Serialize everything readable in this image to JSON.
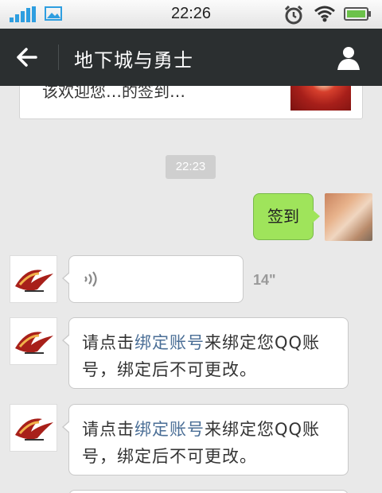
{
  "status_bar": {
    "time": "22:26"
  },
  "header": {
    "title": "地下城与勇士"
  },
  "chat": {
    "previous_card_text": "该欢迎您…的签到…",
    "time_divider": "22:23",
    "sent_message": "签到",
    "voice_message": {
      "duration": "14\""
    },
    "text_messages": [
      {
        "before": "请点击",
        "link": "绑定账号",
        "after": "来绑定您QQ账号，绑定后不可更改。"
      },
      {
        "before": "请点击",
        "link": "绑定账号",
        "after": "来绑定您QQ账号，绑定后不可更改。"
      }
    ]
  },
  "colors": {
    "title_bar": "#2b2f30",
    "chat_background": "#e9e9e9",
    "sent_bubble": "#9fe45b",
    "link": "#4a6e96",
    "status_icon": "#2e9ee0"
  },
  "icons": [
    "signal-icon",
    "photo-icon",
    "alarm-icon",
    "wifi-icon",
    "battery-icon",
    "back-arrow-icon",
    "profile-icon",
    "voice-icon"
  ]
}
